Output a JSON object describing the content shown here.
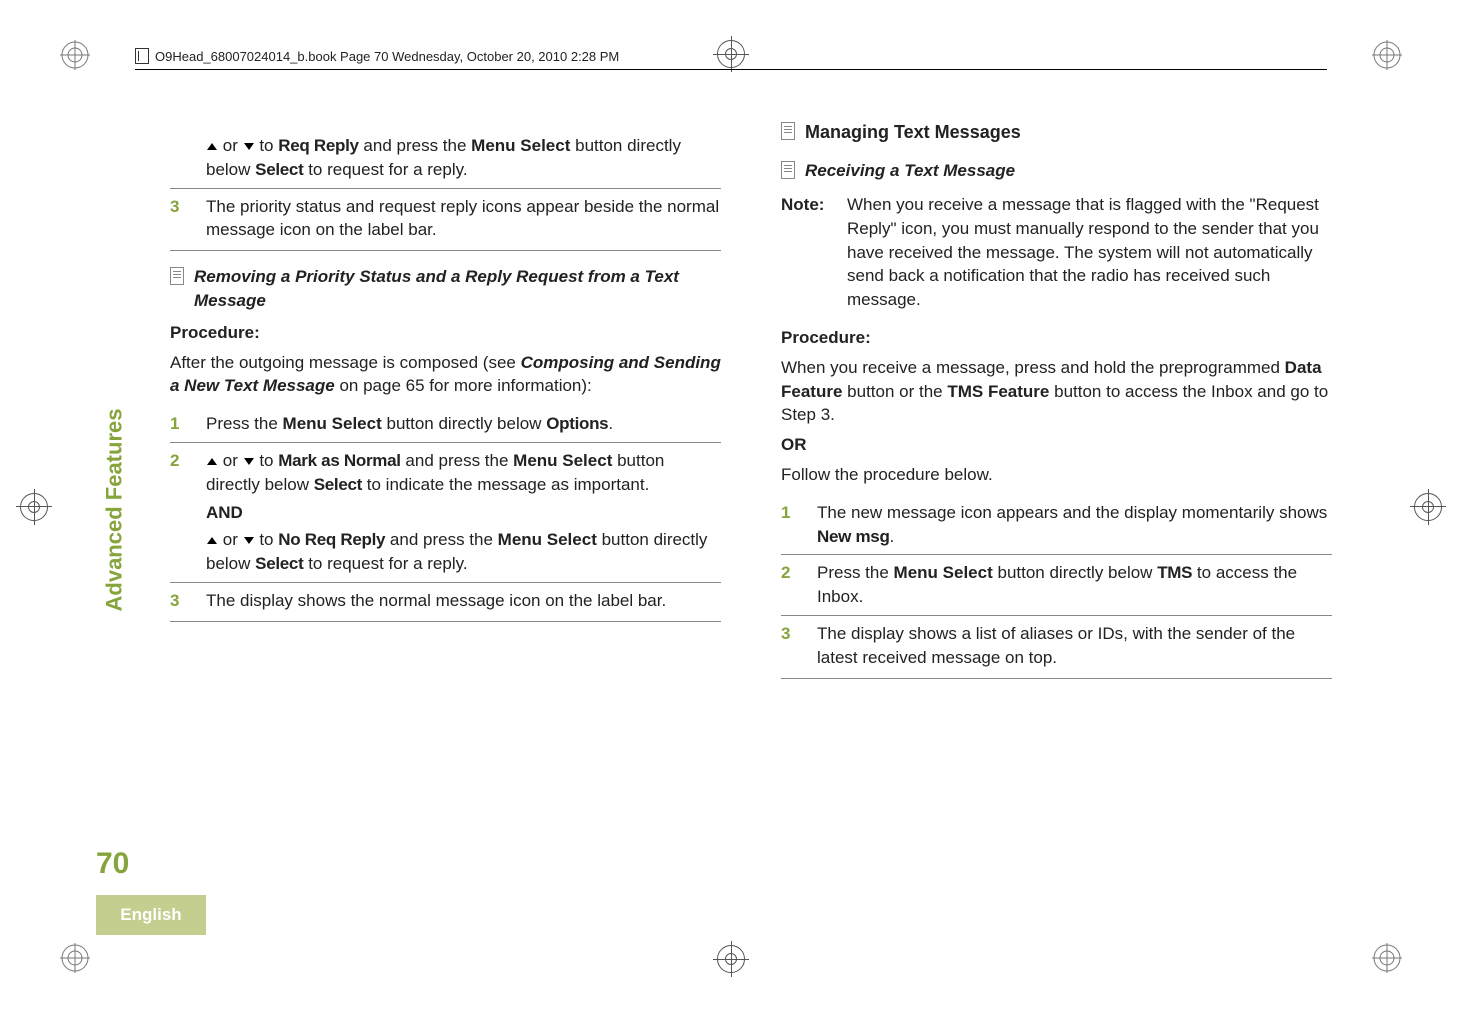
{
  "header": {
    "text": "O9Head_68007024014_b.book  Page 70  Wednesday, October 20, 2010  2:28 PM"
  },
  "sidebar": {
    "tab": "Advanced Features",
    "page_number": "70",
    "language": "English"
  },
  "left": {
    "intro_reply_a": "or",
    "intro_reply_b": "to",
    "ui_req_reply": "Req Reply",
    "intro_reply_c": "and press the",
    "btn_menu_select": "Menu Select",
    "intro_reply_d": "button directly below",
    "ui_select": "Select",
    "intro_reply_e": "to request for a reply.",
    "step3": "The priority status and request reply icons appear beside the normal message icon on the label bar.",
    "subhead_remove": "Removing a Priority Status and a Reply Request from a Text Message",
    "procedure": "Procedure:",
    "compose_intro_a": "After the outgoing message is composed (see",
    "compose_ref": "Composing and Sending a New Text Message",
    "compose_intro_b": "on page 65 for more information):",
    "r_step1_a": "Press the",
    "r_step1_b": "button directly below",
    "ui_options": "Options",
    "r_step2_a": "or",
    "r_step2_b": "to",
    "ui_mark_normal": "Mark as Normal",
    "r_step2_c": "and press the",
    "r_step2_d": "button directly below",
    "r_step2_e": "to indicate the message as important.",
    "and": "AND",
    "r_step2_f": "or",
    "r_step2_g": "to",
    "ui_no_req_reply": "No Req Reply",
    "r_step2_h": "and press the",
    "r_step2_i": "button directly below",
    "r_step2_j": "to request for a reply.",
    "r_step3": "The display shows the normal message icon on the label bar."
  },
  "right": {
    "section_head": "Managing Text Messages",
    "subhead_recv": "Receiving a Text Message",
    "note_label": "Note:",
    "note_body": "When you receive a message that is flagged with the \"Request Reply\" icon, you must manually respond to the sender that you have received the message. The system will not automatically send back a notification that the radio has received such message.",
    "procedure": "Procedure:",
    "proc_a": "When you receive a message, press and hold the preprogrammed",
    "btn_data_feature": "Data Feature",
    "proc_b": "button or the",
    "btn_tms_feature": "TMS Feature",
    "proc_c": "button to access the Inbox and go to Step 3.",
    "or": "OR",
    "proc_d": "Follow the procedure below.",
    "step1_a": "The new message icon appears and the display momentarily shows",
    "ui_new_msg": "New msg",
    "step2_a": "Press the",
    "step2_b": "button directly below",
    "ui_tms": "TMS",
    "step2_c": "to access the Inbox.",
    "step3": "The display shows a list of aliases or IDs, with the sender of the latest received message on top."
  },
  "nums": {
    "n1": "1",
    "n2": "2",
    "n3": "3"
  }
}
